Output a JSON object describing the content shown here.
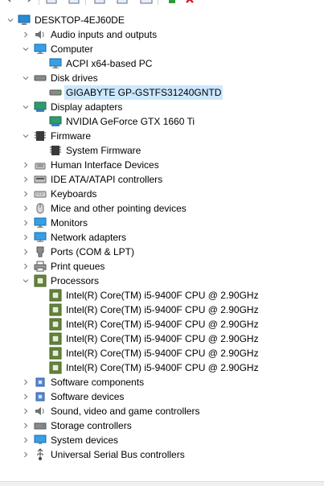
{
  "toolbar": {
    "icons": [
      "back-icon",
      "forward-icon",
      "properties-icon",
      "help-icon",
      "update-driver-icon",
      "scan-icon",
      "enable-device-icon",
      "uninstall-icon"
    ]
  },
  "tree": {
    "root": {
      "label": "DESKTOP-4EJ60DE",
      "icon": "computer-icon"
    },
    "categories": [
      {
        "label": "Audio inputs and outputs",
        "icon": "speaker-icon",
        "expanded": false
      },
      {
        "label": "Computer",
        "icon": "monitor-icon",
        "expanded": true,
        "children": [
          {
            "label": "ACPI x64-based PC",
            "icon": "monitor-icon"
          }
        ]
      },
      {
        "label": "Disk drives",
        "icon": "disk-drive-icon",
        "expanded": true,
        "children": [
          {
            "label": "GIGABYTE GP-GSTFS31240GNTD",
            "icon": "disk-drive-icon",
            "selected": true
          }
        ]
      },
      {
        "label": "Display adapters",
        "icon": "display-adapter-icon",
        "expanded": true,
        "children": [
          {
            "label": "NVIDIA GeForce GTX 1660 Ti",
            "icon": "display-adapter-icon"
          }
        ]
      },
      {
        "label": "Firmware",
        "icon": "firmware-icon",
        "expanded": true,
        "children": [
          {
            "label": "System Firmware",
            "icon": "firmware-icon"
          }
        ]
      },
      {
        "label": "Human Interface Devices",
        "icon": "hid-icon",
        "expanded": false
      },
      {
        "label": "IDE ATA/ATAPI controllers",
        "icon": "ide-controller-icon",
        "expanded": false
      },
      {
        "label": "Keyboards",
        "icon": "keyboard-icon",
        "expanded": false
      },
      {
        "label": "Mice and other pointing devices",
        "icon": "mouse-icon",
        "expanded": false
      },
      {
        "label": "Monitors",
        "icon": "monitor-icon",
        "expanded": false
      },
      {
        "label": "Network adapters",
        "icon": "network-adapter-icon",
        "expanded": false
      },
      {
        "label": "Ports (COM & LPT)",
        "icon": "port-icon",
        "expanded": false
      },
      {
        "label": "Print queues",
        "icon": "printer-icon",
        "expanded": false
      },
      {
        "label": "Processors",
        "icon": "processor-icon",
        "expanded": true,
        "children": [
          {
            "label": "Intel(R) Core(TM) i5-9400F CPU @ 2.90GHz",
            "icon": "processor-icon"
          },
          {
            "label": "Intel(R) Core(TM) i5-9400F CPU @ 2.90GHz",
            "icon": "processor-icon"
          },
          {
            "label": "Intel(R) Core(TM) i5-9400F CPU @ 2.90GHz",
            "icon": "processor-icon"
          },
          {
            "label": "Intel(R) Core(TM) i5-9400F CPU @ 2.90GHz",
            "icon": "processor-icon"
          },
          {
            "label": "Intel(R) Core(TM) i5-9400F CPU @ 2.90GHz",
            "icon": "processor-icon"
          },
          {
            "label": "Intel(R) Core(TM) i5-9400F CPU @ 2.90GHz",
            "icon": "processor-icon"
          }
        ]
      },
      {
        "label": "Software components",
        "icon": "software-component-icon",
        "expanded": false
      },
      {
        "label": "Software devices",
        "icon": "software-device-icon",
        "expanded": false
      },
      {
        "label": "Sound, video and game controllers",
        "icon": "sound-icon",
        "expanded": false
      },
      {
        "label": "Storage controllers",
        "icon": "storage-controller-icon",
        "expanded": false
      },
      {
        "label": "System devices",
        "icon": "system-device-icon",
        "expanded": false
      },
      {
        "label": "Universal Serial Bus controllers",
        "icon": "usb-icon",
        "expanded": false
      }
    ]
  },
  "colors": {
    "selection": "#cce8ff",
    "expander": "#808080"
  }
}
